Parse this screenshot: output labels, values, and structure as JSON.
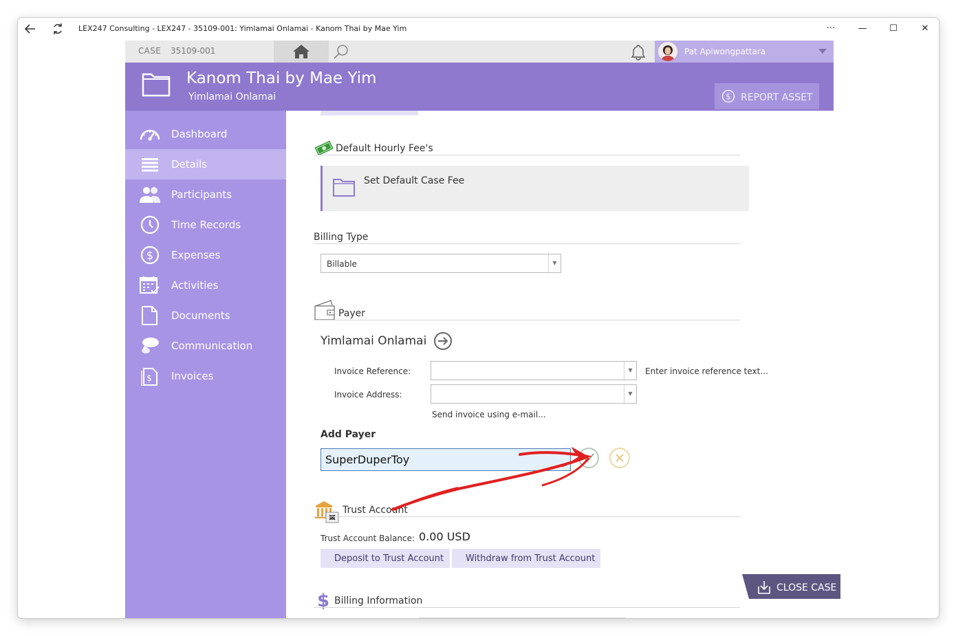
{
  "window": {
    "title": "LEX247 Consulting - LEX247 - 35109-001: Yimlamai Onlamai - Kanom Thai by Mae Yim",
    "back_icon": "back-arrow-icon",
    "refresh_icon": "refresh-icon",
    "more_label": "···",
    "minimize_label": "—",
    "maximize_label": "☐",
    "close_label": "✕"
  },
  "topbar": {
    "case_label": "CASE",
    "case_number": "35109-001",
    "user_name": "Pat Apiwongpattara"
  },
  "header": {
    "title": "Kanom Thai by Mae Yim",
    "subtitle": "Yimlamai Onlamai",
    "report_button": "REPORT ASSET"
  },
  "sidebar": {
    "items": [
      {
        "label": "Dashboard",
        "icon": "dashboard-icon",
        "active": false
      },
      {
        "label": "Details",
        "icon": "details-icon",
        "active": true
      },
      {
        "label": "Participants",
        "icon": "participants-icon",
        "active": false
      },
      {
        "label": "Time Records",
        "icon": "clock-icon",
        "active": false
      },
      {
        "label": "Expenses",
        "icon": "dollar-icon",
        "active": false
      },
      {
        "label": "Activities",
        "icon": "calendar-icon",
        "active": false
      },
      {
        "label": "Documents",
        "icon": "document-icon",
        "active": false
      },
      {
        "label": "Communication",
        "icon": "chat-icon",
        "active": false
      },
      {
        "label": "Invoices",
        "icon": "invoice-icon",
        "active": false
      }
    ]
  },
  "content": {
    "hourly_fee_title": "Default Hourly Fee's",
    "set_fee_label": "Set Default Case Fee",
    "billing_type_title": "Billing Type",
    "billing_type_value": "Billable",
    "payer_title": "Payer",
    "payer_name": "Yimlamai Onlamai",
    "invoice_reference_label": "Invoice Reference:",
    "invoice_reference_value": "",
    "invoice_reference_hint": "Enter invoice reference text...",
    "invoice_address_label": "Invoice Address:",
    "invoice_address_value": "",
    "send_email_label": "Send invoice using e-mail...",
    "add_payer_label": "Add Payer",
    "add_payer_value": "SuperDuperToy",
    "trust_title": "Trust Account",
    "trust_balance_label": "Trust Account Balance:",
    "trust_balance_value": "0.00 USD",
    "deposit_label": "Deposit to Trust Account",
    "withdraw_label": "Withdraw from Trust Account",
    "billing_info_title": "Billing Information"
  },
  "close_case_label": "CLOSE CASE",
  "colors": {
    "brand": "#8e79cf",
    "sidebar": "#a794e5",
    "sidebar_active": "#c1b4ef",
    "annotation_arrow": "#e02020"
  }
}
